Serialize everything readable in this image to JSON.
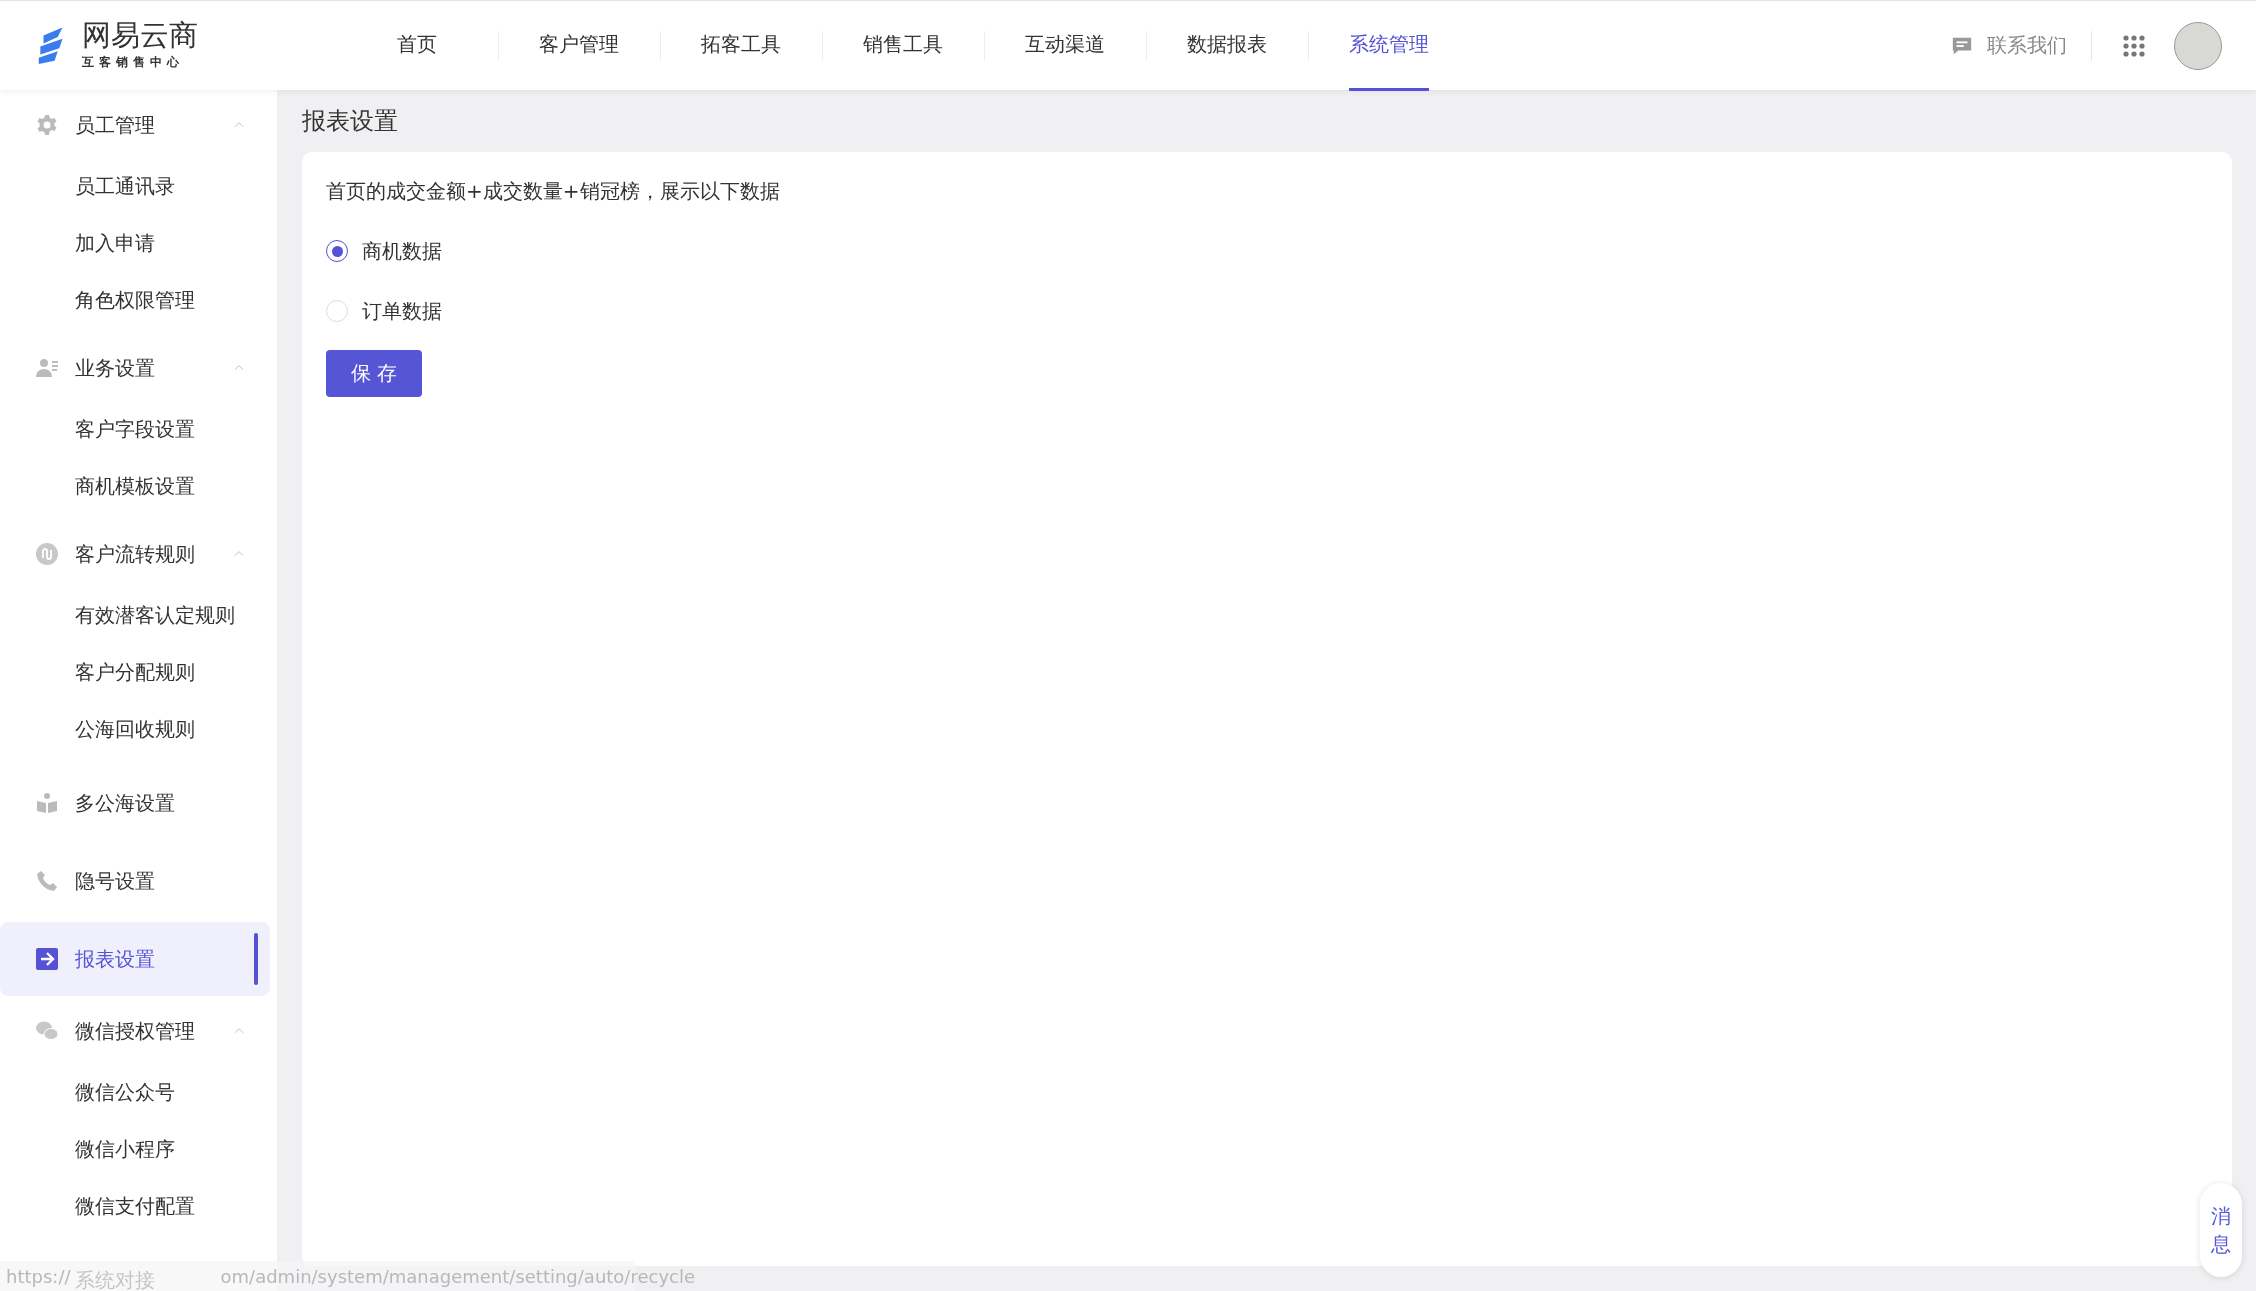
{
  "header": {
    "logo": {
      "name": "网易云商",
      "subtitle": "互客销售中心"
    },
    "tabs": [
      {
        "label": "首页",
        "selected": false
      },
      {
        "label": "客户管理",
        "selected": false
      },
      {
        "label": "拓客工具",
        "selected": false
      },
      {
        "label": "销售工具",
        "selected": false
      },
      {
        "label": "互动渠道",
        "selected": false
      },
      {
        "label": "数据报表",
        "selected": false
      },
      {
        "label": "系统管理",
        "selected": true
      }
    ],
    "contact": "联系我们"
  },
  "sidebar": {
    "items": [
      {
        "label": "员工管理",
        "expanded": true,
        "selected": false,
        "children": [
          {
            "label": "员工通讯录"
          },
          {
            "label": "加入申请"
          },
          {
            "label": "角色权限管理"
          }
        ]
      },
      {
        "label": "业务设置",
        "expanded": true,
        "selected": false,
        "children": [
          {
            "label": "客户字段设置"
          },
          {
            "label": "商机模板设置"
          }
        ]
      },
      {
        "label": "客户流转规则",
        "expanded": true,
        "selected": false,
        "children": [
          {
            "label": "有效潜客认定规则"
          },
          {
            "label": "客户分配规则"
          },
          {
            "label": "公海回收规则"
          }
        ]
      },
      {
        "label": "多公海设置",
        "selected": false
      },
      {
        "label": "隐号设置",
        "selected": false
      },
      {
        "label": "报表设置",
        "selected": true
      },
      {
        "label": "微信授权管理",
        "expanded": true,
        "selected": false,
        "children": [
          {
            "label": "微信公众号"
          },
          {
            "label": "微信小程序"
          },
          {
            "label": "微信支付配置"
          }
        ]
      },
      {
        "label": "系统对接",
        "selected": false
      }
    ]
  },
  "main": {
    "title": "报表设置",
    "description": "首页的成交金额+成交数量+销冠榜，展示以下数据",
    "options": [
      {
        "label": "商机数据",
        "selected": true
      },
      {
        "label": "订单数据",
        "selected": false
      }
    ],
    "save_button": "保 存"
  },
  "float_button": "消息",
  "status_bar": {
    "url_start": "https://",
    "url_end": "om/admin/system/management/setting/auto/recycle"
  }
}
